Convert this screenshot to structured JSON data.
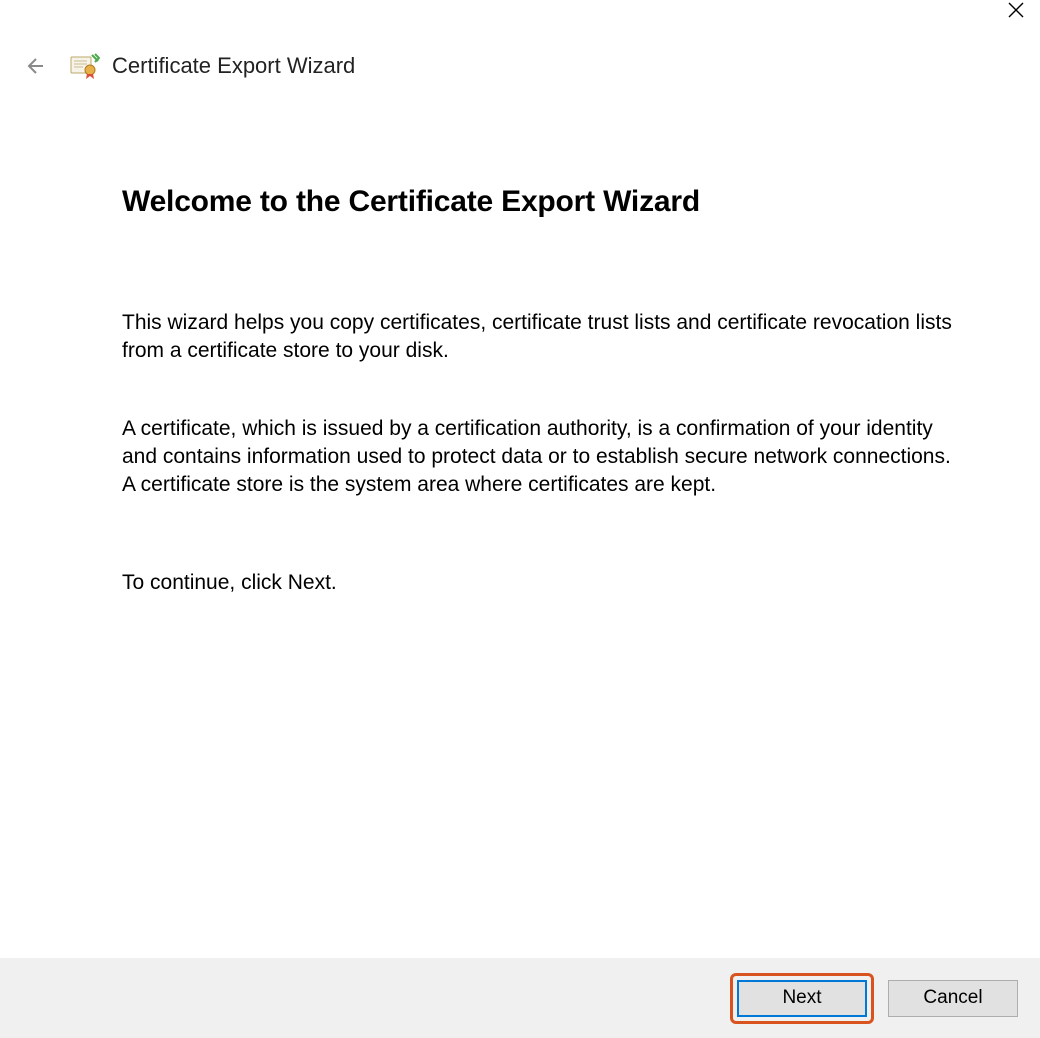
{
  "window": {
    "title": "Certificate Export Wizard"
  },
  "main": {
    "heading": "Welcome to the Certificate Export Wizard",
    "paragraph1": "This wizard helps you copy certificates, certificate trust lists and certificate revocation lists from a certificate store to your disk.",
    "paragraph2": "A certificate, which is issued by a certification authority, is a confirmation of your identity and contains information used to protect data or to establish secure network connections. A certificate store is the system area where certificates are kept.",
    "paragraph3": "To continue, click Next."
  },
  "footer": {
    "next_label": "Next",
    "cancel_label": "Cancel"
  }
}
